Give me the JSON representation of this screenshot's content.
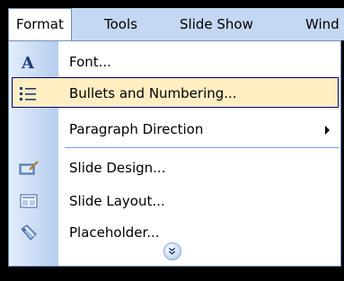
{
  "menubar": {
    "items": [
      {
        "label": "Format",
        "active": true
      },
      {
        "label": "Tools"
      },
      {
        "label": "Slide Show"
      },
      {
        "label": "Wind"
      }
    ]
  },
  "menu": {
    "items": [
      {
        "label": "Font...",
        "icon": "font-icon"
      },
      {
        "label": "Bullets and Numbering...",
        "icon": "bullets-icon",
        "highlighted": true
      },
      {
        "label": "Paragraph Direction",
        "icon": null,
        "has_submenu": true
      },
      {
        "label": "Slide Design...",
        "icon": "slide-design-icon"
      },
      {
        "label": "Slide Layout...",
        "icon": "slide-layout-icon"
      },
      {
        "label": "Placeholder...",
        "icon": "placeholder-icon"
      }
    ],
    "expand_icon": "chevron-double-down-icon"
  },
  "colors": {
    "menubar_bg": "#c4d8f3",
    "highlight_bg": "#ffeec2",
    "highlight_border": "#000080",
    "gutter_light": "#e3eefc",
    "gutter_dark": "#b6cdef"
  }
}
